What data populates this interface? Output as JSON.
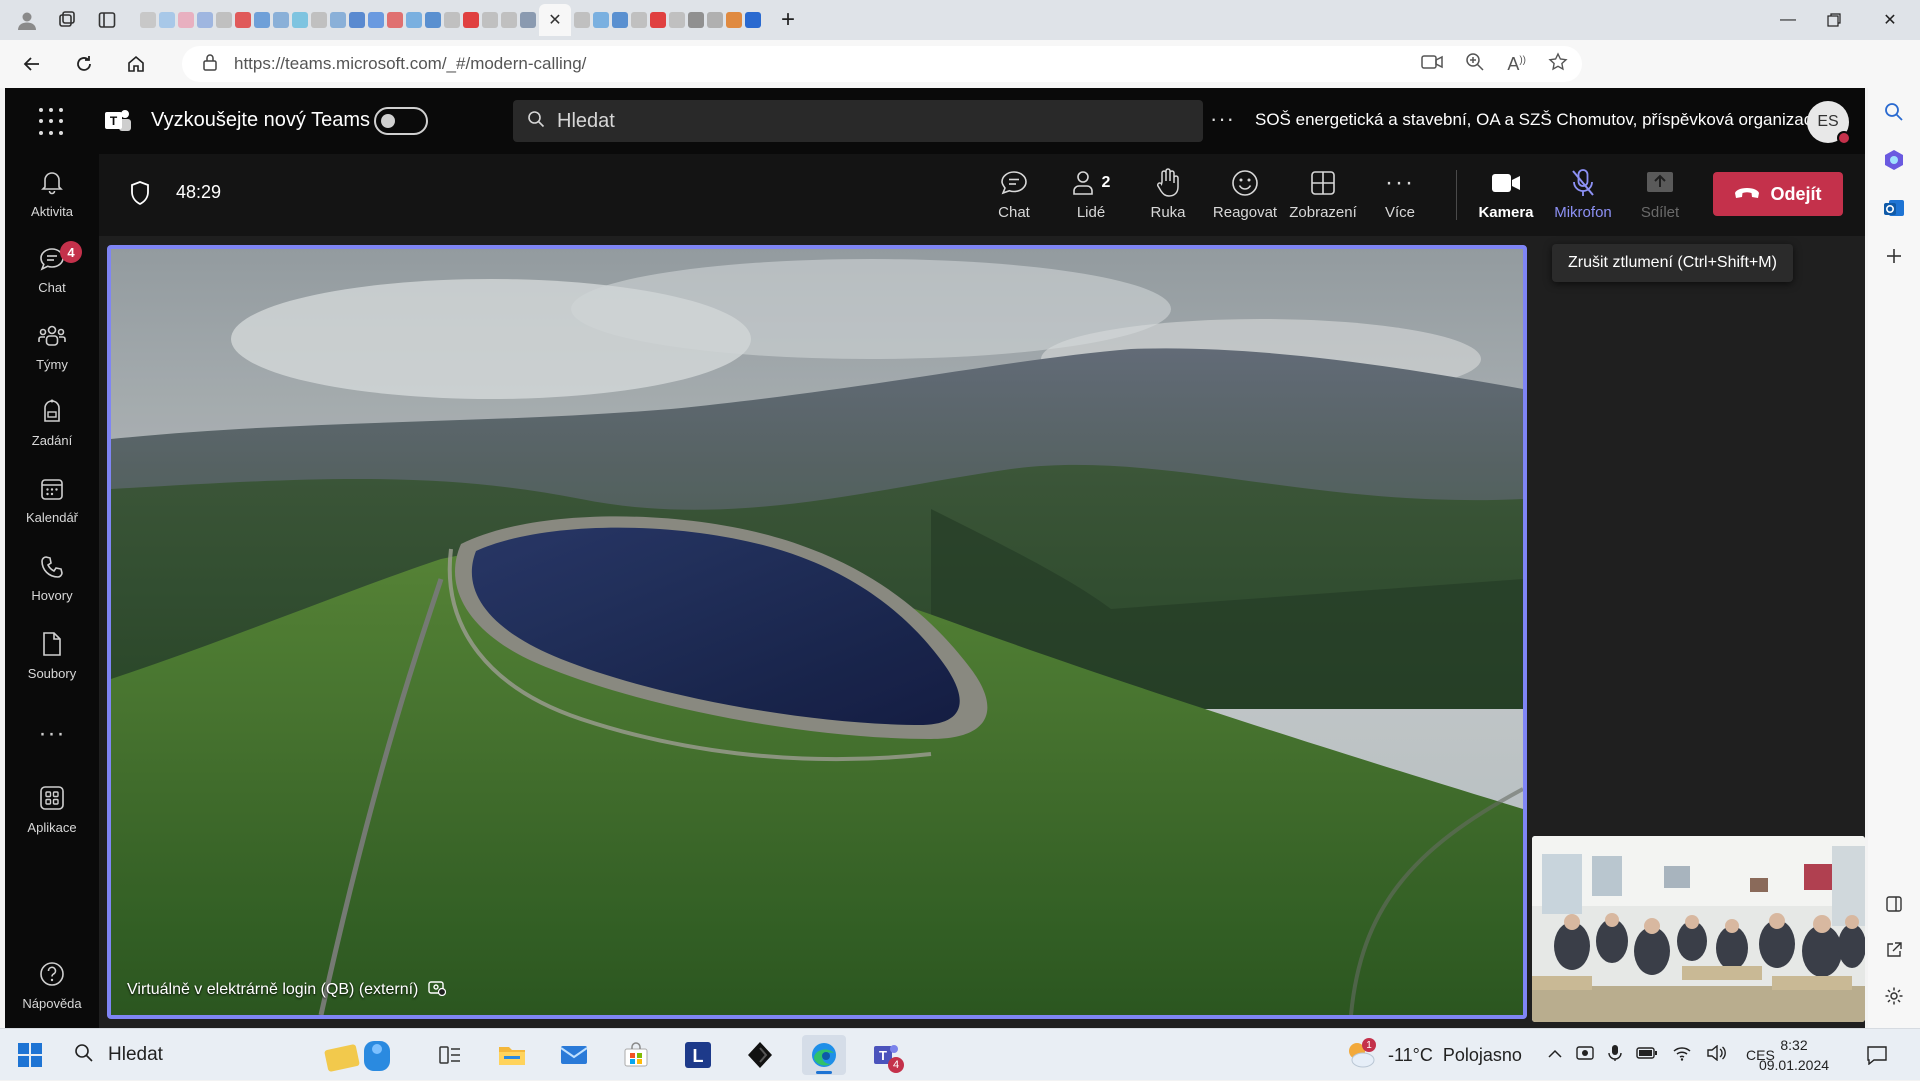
{
  "browser": {
    "url": "https://teams.microsoft.com/_#/modern-calling/",
    "tab_favicon_colors": [
      "#c8c8c8",
      "#a8c8e8",
      "#e8b0c0",
      "#9fb6e0",
      "#c0c0c0",
      "#e05a5a",
      "#6fa0d8",
      "#8ab0d8",
      "#7ec4e0",
      "#c0c0c0",
      "#8ab0d8",
      "#5a8ad0",
      "#6a9ae0",
      "#e07070",
      "#7ab0e0",
      "#5a90d0",
      "#c0c0c0",
      "#e04040",
      "#c0c0c0",
      "#c0c0c0",
      "#8a9ab0",
      "#c0c0c0",
      "#7ab0e0",
      "#5a90d0",
      "#c0c0c0",
      "#e04040",
      "#c0c0c0",
      "#909090",
      "#b0b0b0",
      "#e08a40",
      "#2a6ad0"
    ]
  },
  "teams": {
    "try_new_label": "Vyzkoušejte nový Teams",
    "search_placeholder": "Hledat",
    "org_name": "SOŠ energetická a stavební, OA a SZŠ Chomutov, příspěvková organizace",
    "user_initials": "ES",
    "rail": [
      {
        "label": "Aktivita",
        "icon": "bell-icon"
      },
      {
        "label": "Chat",
        "icon": "chat-icon",
        "badge": "4"
      },
      {
        "label": "Týmy",
        "icon": "teams-icon"
      },
      {
        "label": "Zadání",
        "icon": "assignments-icon"
      },
      {
        "label": "Kalendář",
        "icon": "calendar-icon"
      },
      {
        "label": "Hovory",
        "icon": "phone-icon"
      },
      {
        "label": "Soubory",
        "icon": "file-icon"
      },
      {
        "label": "Aplikace",
        "icon": "apps-icon"
      },
      {
        "label": "Nápověda",
        "icon": "help-icon"
      }
    ]
  },
  "meeting": {
    "timer": "48:29",
    "controls": {
      "chat": "Chat",
      "people": "Lidé",
      "people_count": "2",
      "raise": "Ruka",
      "react": "Reagovat",
      "view": "Zobrazení",
      "more": "Více",
      "camera": "Kamera",
      "mic": "Mikrofon",
      "share": "Sdílet",
      "leave": "Odejít"
    },
    "tooltip": "Zrušit ztlumení (Ctrl+Shift+M)",
    "stage_label": "Virtuálně v elektrárně login (QB) (externí)",
    "accent": "#7f85f5",
    "leave_color": "#c4314b"
  },
  "taskbar": {
    "search": "Hledat",
    "weather": "-11°C  Polojasno",
    "weather_badge": "1",
    "lang": "CES",
    "time": "8:32",
    "date": "09.01.2024",
    "teams_badge": "4"
  }
}
